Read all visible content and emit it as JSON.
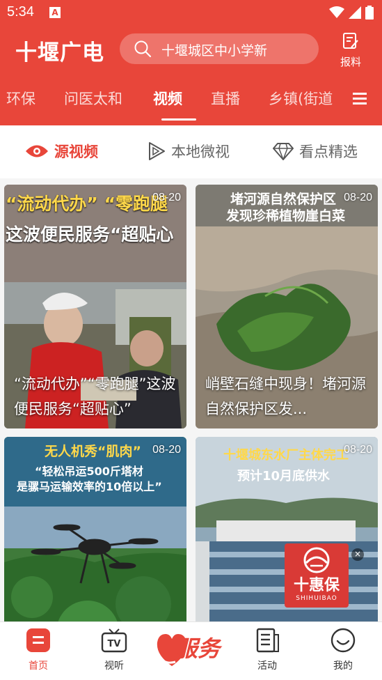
{
  "status_bar": {
    "time": "5:34",
    "notification": "A"
  },
  "header": {
    "logo": "十堰广电",
    "search_placeholder": "十堰城区中小学新",
    "report_label": "报料"
  },
  "tabs": [
    "环保",
    "问医太和",
    "视频",
    "直播",
    "乡镇(街道"
  ],
  "active_tab": "视频",
  "subtabs": [
    "源视频",
    "本地微视",
    "看点精选"
  ],
  "cards": [
    {
      "date": "08-20",
      "caption": "“流动代办”“零跑腿”这波便民服务“超贴心”",
      "overlay_line1": "“流动代办” “零跑腿",
      "overlay_line2": "这波便民服务“超贴心"
    },
    {
      "date": "08-20",
      "caption": "峭壁石缝中现身！堵河源自然保护区发...",
      "overlay_line1": "堵河源自然保护区",
      "overlay_line2": "发现珍稀植物崖白菜"
    },
    {
      "date": "08-20",
      "overlay_line1": "无人机秀“肌肉”",
      "overlay_line2": "“轻松吊运500斤塔材",
      "overlay_line3": "是骡马运输效率的10倍以上”"
    },
    {
      "date": "08-20",
      "overlay_line1": "十堰城东水厂主体完工",
      "overlay_line2": "预计10月底供水"
    }
  ],
  "promo": {
    "brand": "十惠保",
    "brand_en": "SHIHUIBAO"
  },
  "bottom_nav": [
    {
      "label": "首页",
      "icon": "home-icon"
    },
    {
      "label": "视听",
      "icon": "tv-icon"
    },
    {
      "label": "活动",
      "icon": "document-icon"
    },
    {
      "label": "我的",
      "icon": "smile-icon"
    }
  ],
  "service_label": "服务",
  "colors": {
    "brand_red": "#e8463a"
  }
}
